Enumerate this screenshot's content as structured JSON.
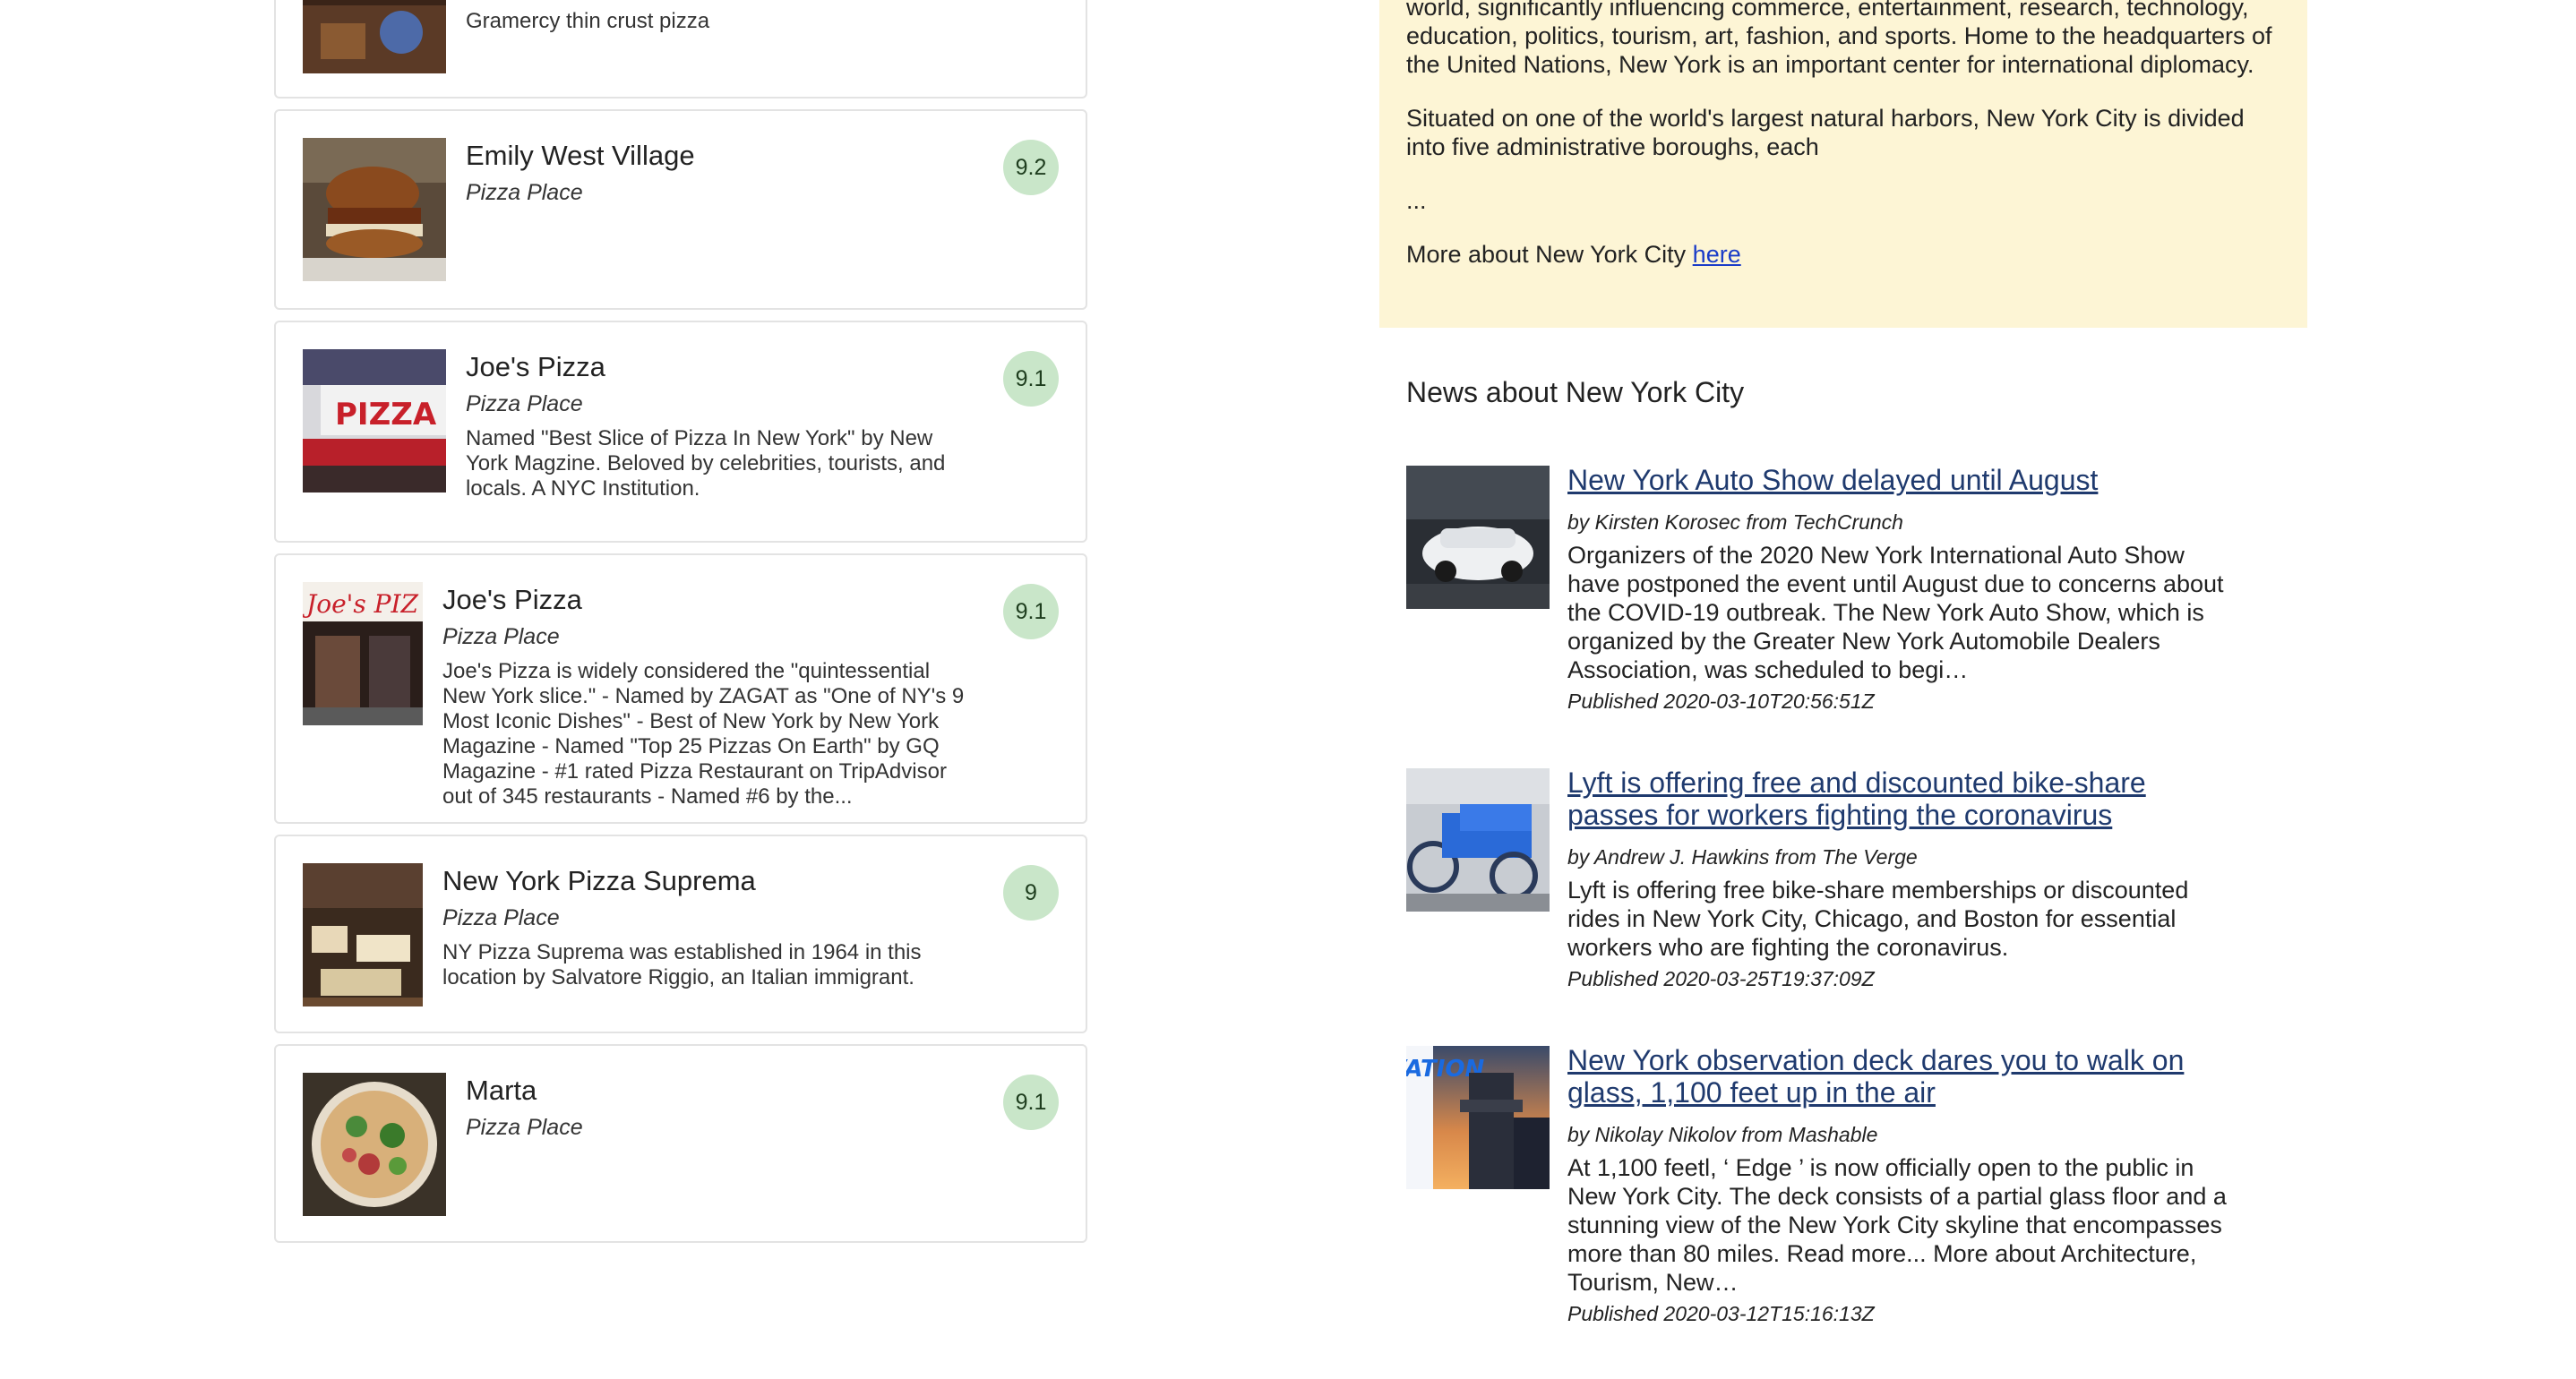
{
  "venues": [
    {
      "name": "",
      "category": "",
      "score": "",
      "description": "Gramercy thin crust pizza"
    },
    {
      "name": "Emily West Village",
      "category": "Pizza Place",
      "score": "9.2",
      "description": ""
    },
    {
      "name": "Joe's Pizza",
      "category": "Pizza Place",
      "score": "9.1",
      "description": "Named \"Best Slice of Pizza In New York\" by New York Magzine. Beloved by celebrities, tourists, and locals. A NYC Institution."
    },
    {
      "name": "Joe's Pizza",
      "category": "Pizza Place",
      "score": "9.1",
      "description": "Joe's Pizza is widely considered the \"quintessential New York slice.\" - Named by ZAGAT as \"One of NY's 9 Most Iconic Dishes\" - Best of New York by New York Magazine - Named \"Top 25 Pizzas On Earth\" by GQ Magazine - #1 rated Pizza Restaurant on TripAdvisor out of 345 restaurants - Named #6 by the..."
    },
    {
      "name": "New York Pizza Suprema",
      "category": "Pizza Place",
      "score": "9",
      "description": "NY Pizza Suprema was established in 1964 in this location by Salvatore Riggio, an Italian immigrant."
    },
    {
      "name": "Marta",
      "category": "Pizza Place",
      "score": "9.1",
      "description": ""
    }
  ],
  "about": {
    "paragraph_1": "world, significantly influencing commerce, entertainment, research, technology, education, politics, tourism, art, fashion, and sports. Home to the headquarters of the United Nations, New York is an important center for international diplomacy.",
    "paragraph_2": "Situated on one of the world's largest natural harbors, New York City is divided into five administrative boroughs, each",
    "ellipsis": "...",
    "more_text": "More about New York City",
    "more_link": "here"
  },
  "news": {
    "title": "News about New York City",
    "items": [
      {
        "headline": "New York Auto Show delayed until August",
        "byline": "by Kirsten Korosec from TechCrunch",
        "description": "Organizers of the 2020 New York International Auto Show have postponed the event until August due to concerns about the COVID-19 outbreak. The New York Auto Show, which is organized by the Greater New York Automobile Dealers Association, was scheduled to begi…",
        "published": "Published 2020-03-10T20:56:51Z"
      },
      {
        "headline": "Lyft is offering free and discounted bike-share passes for workers fighting the coronavirus",
        "byline": "by Andrew J. Hawkins from The Verge",
        "description": "Lyft is offering free bike-share memberships or discounted rides in New York City, Chicago, and Boston for essential workers who are fighting the coronavirus.",
        "published": "Published 2020-03-25T19:37:09Z"
      },
      {
        "headline": "New York observation deck dares you to walk on glass, 1,100 feet up in the air",
        "byline": "by Nikolay Nikolov from Mashable",
        "description": "At 1,100 feetl, ‘ Edge ’ is now officially open to the public in New York City. The deck consists of a partial glass floor and a stunning view of the New York City skyline that encompasses more than 80 miles. Read more... More about Architecture, Tourism, New…",
        "published": "Published 2020-03-12T15:16:13Z"
      }
    ]
  },
  "colors": {
    "score_badge": "#c9e6c9",
    "about_background": "#fdf5d5",
    "headline_link": "#1f3a6e",
    "card_border": "#e3e3e3"
  }
}
